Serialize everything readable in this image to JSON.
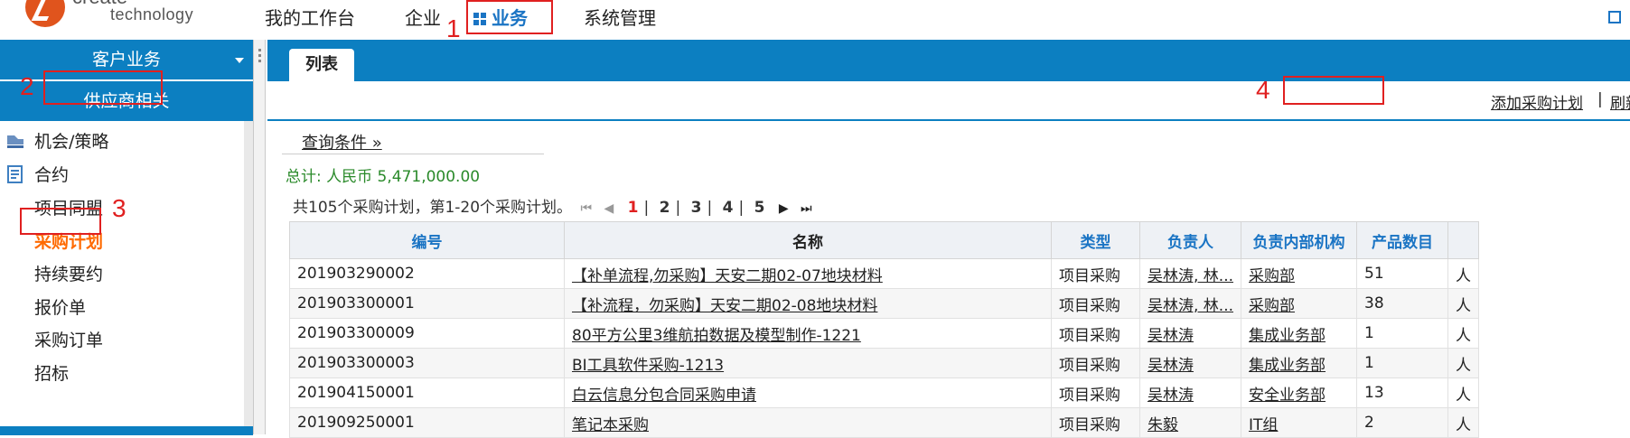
{
  "app": {
    "logo_name": "create",
    "logo_sub": "technology"
  },
  "topnav": {
    "items": [
      {
        "label": "我的工作台"
      },
      {
        "label": "企业"
      },
      {
        "label": "业务"
      },
      {
        "label": "系统管理"
      }
    ]
  },
  "annotations": {
    "n1": "1",
    "n2": "2",
    "n3": "3",
    "n4": "4"
  },
  "sidebar": {
    "header": "客户业务",
    "section": "供应商相关",
    "items": [
      {
        "label": "机会/策略",
        "icon": "opportunity-icon"
      },
      {
        "label": "合约",
        "icon": "contract-icon"
      },
      {
        "label": "项目同盟"
      },
      {
        "label": "采购计划"
      },
      {
        "label": "持续要约"
      },
      {
        "label": "报价单"
      },
      {
        "label": "采购订单"
      },
      {
        "label": "招标"
      }
    ]
  },
  "main": {
    "tab": "列表",
    "actions": {
      "add": "添加采购计划",
      "separator": "|",
      "refresh": "刷新"
    },
    "query": "查询条件 »",
    "total": "总计: 人民币 5,471,000.00",
    "pager": {
      "summary": "共105个采购计划，第1-20个采购计划。",
      "pages": [
        "1",
        "2",
        "3",
        "4",
        "5"
      ],
      "separator": "|"
    },
    "table": {
      "columns": [
        "编号",
        "名称",
        "类型",
        "负责人",
        "负责内部机构",
        "产品数目"
      ],
      "rows": [
        {
          "id": "201903290002",
          "name": "【补单流程,勿采购】天安二期02-07地块材料",
          "type": "项目采购",
          "owner": "吴林涛, 林...",
          "dept": "采购部",
          "count": "51",
          "extra": "人"
        },
        {
          "id": "201903300001",
          "name": "【补流程，勿采购】天安二期02-08地块材料",
          "type": "项目采购",
          "owner": "吴林涛, 林...",
          "dept": "采购部",
          "count": "38",
          "extra": "人"
        },
        {
          "id": "201903300009",
          "name": "80平方公里3维航拍数据及模型制作-1221",
          "type": "项目采购",
          "owner": "吴林涛",
          "dept": "集成业务部",
          "count": "1",
          "extra": "人"
        },
        {
          "id": "201903300003",
          "name": "BI工具软件采购-1213",
          "type": "项目采购",
          "owner": "吴林涛",
          "dept": "集成业务部",
          "count": "1",
          "extra": "人"
        },
        {
          "id": "201904150001",
          "name": "白云信息分包合同采购申请",
          "type": "项目采购",
          "owner": "吴林涛",
          "dept": "安全业务部",
          "count": "13",
          "extra": "人"
        },
        {
          "id": "201909250001",
          "name": "笔记本采购",
          "type": "项目采购",
          "owner": "朱毅",
          "dept": "IT组",
          "count": "2",
          "extra": "人"
        }
      ]
    }
  }
}
